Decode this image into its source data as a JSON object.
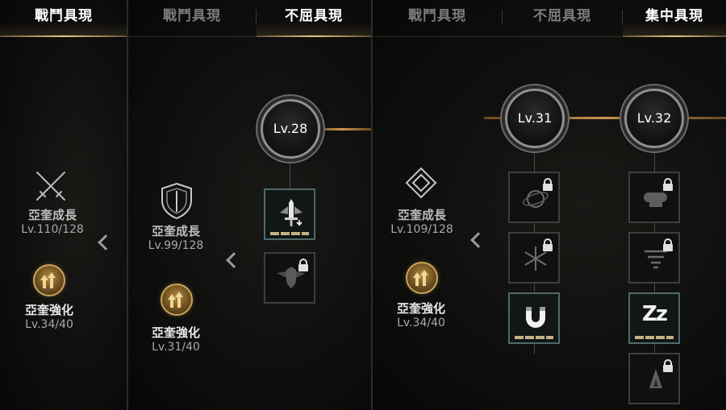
{
  "panel1": {
    "tabs": [
      {
        "label": "戰鬥具現",
        "active": true
      }
    ],
    "growth": {
      "name": "亞奎成長",
      "level": "Lv.110/128"
    },
    "enhance": {
      "name": "亞奎強化",
      "level": "Lv.34/40"
    }
  },
  "panel2": {
    "tabs": [
      {
        "label": "戰鬥具現",
        "active": false
      },
      {
        "label": "不屈具現",
        "active": true
      }
    ],
    "growth": {
      "name": "亞奎成長",
      "level": "Lv.99/128"
    },
    "enhance": {
      "name": "亞奎強化",
      "level": "Lv.31/40"
    },
    "node": {
      "label": "Lv.28"
    },
    "slots": [
      {
        "icon": "sword-icon",
        "locked": false,
        "equipped": true
      },
      {
        "icon": "winged-shield-icon",
        "locked": true,
        "equipped": false
      }
    ]
  },
  "panel3": {
    "tabs": [
      {
        "label": "戰鬥具現",
        "active": false
      },
      {
        "label": "不屈具現",
        "active": false
      },
      {
        "label": "集中具現",
        "active": true
      }
    ],
    "growth": {
      "name": "亞奎成長",
      "level": "Lv.109/128"
    },
    "enhance": {
      "name": "亞奎強化",
      "level": "Lv.34/40"
    },
    "nodes": [
      {
        "label": "Lv.31"
      },
      {
        "label": "Lv.32"
      }
    ],
    "col1_slots": [
      {
        "icon": "orbit-sphere-icon",
        "locked": true
      },
      {
        "icon": "snowflake-icon",
        "locked": true
      },
      {
        "icon": "magnet-icon",
        "locked": false
      }
    ],
    "col2_slots": [
      {
        "icon": "fist-icon",
        "locked": true
      },
      {
        "icon": "whirlwind-icon",
        "locked": true
      },
      {
        "icon": "sleep-icon",
        "locked": false,
        "text": "Zz"
      },
      {
        "icon": "flame-gauntlet-icon",
        "locked": true
      }
    ]
  },
  "colors": {
    "accent_gold": "#c99452",
    "tab_active": "#ffffff",
    "tab_inactive": "#7c7c7c"
  }
}
